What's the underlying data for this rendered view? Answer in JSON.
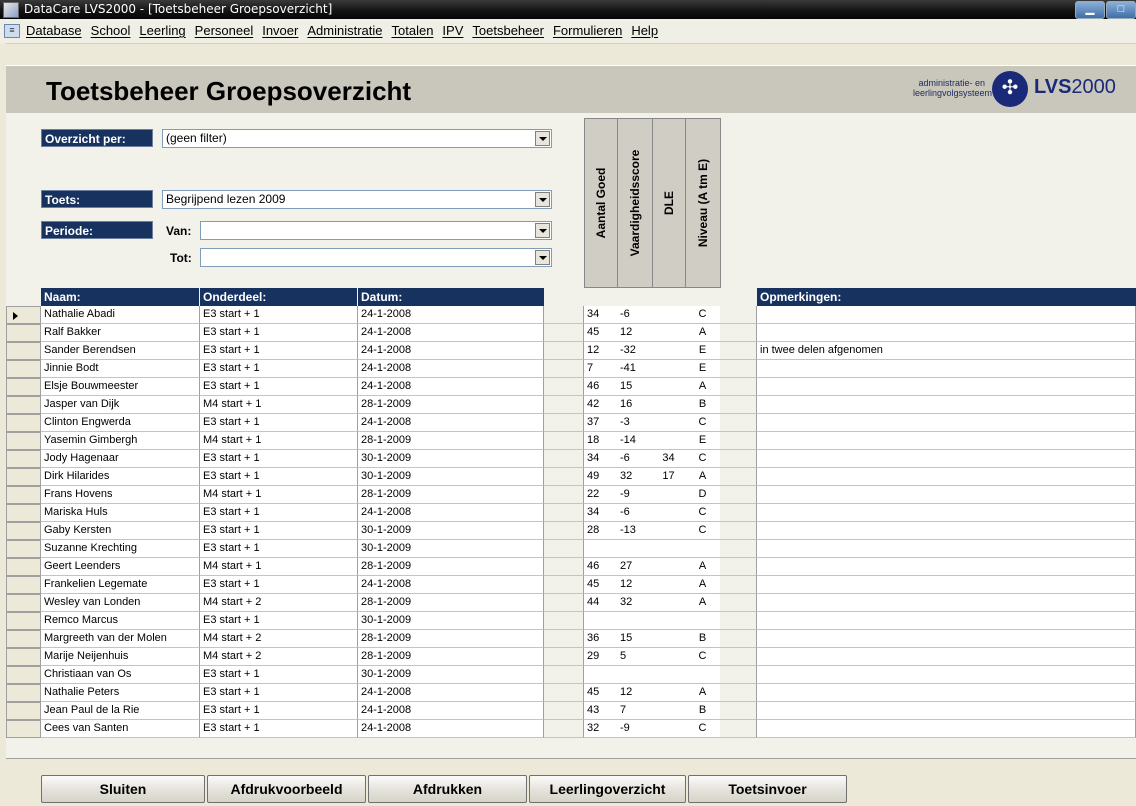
{
  "window": {
    "title": "DataCare LVS2000 - [Toetsbeheer Groepsoverzicht]",
    "buttons": [
      "▁",
      "□"
    ]
  },
  "menu": [
    "Database",
    "School",
    "Leerling",
    "Personeel",
    "Invoer",
    "Administratie",
    "Totalen",
    "IPV",
    "Toetsbeheer",
    "Formulieren",
    "Help"
  ],
  "header": {
    "title": "Toetsbeheer Groepsoverzicht",
    "logo_line1": "administratie- en",
    "logo_line2": "leerlingvolgsysteem",
    "logo_lvs": "LVS",
    "logo_year": "2000"
  },
  "filters": {
    "overzicht_label": "Overzicht per:",
    "overzicht_value": "(geen filter)",
    "toets_label": "Toets:",
    "toets_value": "Begrijpend lezen 2009",
    "periode_label": "Periode:",
    "van_label": "Van:",
    "van_value": "",
    "tot_label": "Tot:",
    "tot_value": ""
  },
  "vertical_headers": [
    "Aantal Goed",
    "Vaardigheidsscore",
    "DLE",
    "Niveau (A tm E)"
  ],
  "grid_headers": {
    "naam": "Naam:",
    "onderdeel": "Onderdeel:",
    "datum": "Datum:",
    "opmerkingen": "Opmerkingen:"
  },
  "rows": [
    {
      "naam": "Nathalie Abadi",
      "onderdeel": "E3 start + 1",
      "datum": "24-1-2008",
      "goed": "34",
      "vaard": "-6",
      "dle": "",
      "niveau": "C",
      "opm": ""
    },
    {
      "naam": "Ralf Bakker",
      "onderdeel": "E3 start + 1",
      "datum": "24-1-2008",
      "goed": "45",
      "vaard": "12",
      "dle": "",
      "niveau": "A",
      "opm": ""
    },
    {
      "naam": "Sander Berendsen",
      "onderdeel": "E3 start + 1",
      "datum": "24-1-2008",
      "goed": "12",
      "vaard": "-32",
      "dle": "",
      "niveau": "E",
      "opm": "in twee delen afgenomen"
    },
    {
      "naam": "Jinnie Bodt",
      "onderdeel": "E3 start + 1",
      "datum": "24-1-2008",
      "goed": "7",
      "vaard": "-41",
      "dle": "",
      "niveau": "E",
      "opm": ""
    },
    {
      "naam": "Elsje Bouwmeester",
      "onderdeel": "E3 start + 1",
      "datum": "24-1-2008",
      "goed": "46",
      "vaard": "15",
      "dle": "",
      "niveau": "A",
      "opm": ""
    },
    {
      "naam": "Jasper van Dijk",
      "onderdeel": "M4 start + 1",
      "datum": "28-1-2009",
      "goed": "42",
      "vaard": "16",
      "dle": "",
      "niveau": "B",
      "opm": ""
    },
    {
      "naam": "Clinton Engwerda",
      "onderdeel": "E3 start + 1",
      "datum": "24-1-2008",
      "goed": "37",
      "vaard": "-3",
      "dle": "",
      "niveau": "C",
      "opm": ""
    },
    {
      "naam": "Yasemin Gimbergh",
      "onderdeel": "M4 start + 1",
      "datum": "28-1-2009",
      "goed": "18",
      "vaard": "-14",
      "dle": "",
      "niveau": "E",
      "opm": ""
    },
    {
      "naam": "Jody Hagenaar",
      "onderdeel": "E3 start + 1",
      "datum": "30-1-2009",
      "goed": "34",
      "vaard": "-6",
      "dle": "34",
      "niveau": "C",
      "opm": ""
    },
    {
      "naam": "Dirk Hilarides",
      "onderdeel": "E3 start + 1",
      "datum": "30-1-2009",
      "goed": "49",
      "vaard": "32",
      "dle": "17",
      "niveau": "A",
      "opm": ""
    },
    {
      "naam": "Frans Hovens",
      "onderdeel": "M4 start + 1",
      "datum": "28-1-2009",
      "goed": "22",
      "vaard": "-9",
      "dle": "",
      "niveau": "D",
      "opm": ""
    },
    {
      "naam": "Mariska Huls",
      "onderdeel": "E3 start + 1",
      "datum": "24-1-2008",
      "goed": "34",
      "vaard": "-6",
      "dle": "",
      "niveau": "C",
      "opm": ""
    },
    {
      "naam": "Gaby Kersten",
      "onderdeel": "E3 start + 1",
      "datum": "30-1-2009",
      "goed": "28",
      "vaard": "-13",
      "dle": "",
      "niveau": "C",
      "opm": ""
    },
    {
      "naam": "Suzanne Krechting",
      "onderdeel": "E3 start + 1",
      "datum": "30-1-2009",
      "goed": "",
      "vaard": "",
      "dle": "",
      "niveau": "",
      "opm": ""
    },
    {
      "naam": "Geert Leenders",
      "onderdeel": "M4 start + 1",
      "datum": "28-1-2009",
      "goed": "46",
      "vaard": "27",
      "dle": "",
      "niveau": "A",
      "opm": ""
    },
    {
      "naam": "Frankelien Legemate",
      "onderdeel": "E3 start + 1",
      "datum": "24-1-2008",
      "goed": "45",
      "vaard": "12",
      "dle": "",
      "niveau": "A",
      "opm": ""
    },
    {
      "naam": "Wesley van Londen",
      "onderdeel": "M4 start + 2",
      "datum": "28-1-2009",
      "goed": "44",
      "vaard": "32",
      "dle": "",
      "niveau": "A",
      "opm": ""
    },
    {
      "naam": "Remco Marcus",
      "onderdeel": "E3 start + 1",
      "datum": "30-1-2009",
      "goed": "",
      "vaard": "",
      "dle": "",
      "niveau": "",
      "opm": ""
    },
    {
      "naam": "Margreeth van der Molen",
      "onderdeel": "M4 start + 2",
      "datum": "28-1-2009",
      "goed": "36",
      "vaard": "15",
      "dle": "",
      "niveau": "B",
      "opm": ""
    },
    {
      "naam": "Marije Neijenhuis",
      "onderdeel": "M4 start + 2",
      "datum": "28-1-2009",
      "goed": "29",
      "vaard": "5",
      "dle": "",
      "niveau": "C",
      "opm": ""
    },
    {
      "naam": "Christiaan van Os",
      "onderdeel": "E3 start + 1",
      "datum": "30-1-2009",
      "goed": "",
      "vaard": "",
      "dle": "",
      "niveau": "",
      "opm": ""
    },
    {
      "naam": "Nathalie Peters",
      "onderdeel": "E3 start + 1",
      "datum": "24-1-2008",
      "goed": "45",
      "vaard": "12",
      "dle": "",
      "niveau": "A",
      "opm": ""
    },
    {
      "naam": "Jean Paul de la Rie",
      "onderdeel": "E3 start + 1",
      "datum": "24-1-2008",
      "goed": "43",
      "vaard": "7",
      "dle": "",
      "niveau": "B",
      "opm": ""
    },
    {
      "naam": "Cees van Santen",
      "onderdeel": "E3 start + 1",
      "datum": "24-1-2008",
      "goed": "32",
      "vaard": "-9",
      "dle": "",
      "niveau": "C",
      "opm": ""
    }
  ],
  "footer_buttons": [
    "Sluiten",
    "Afdrukvoorbeeld",
    "Afdrukken",
    "Leerlingoverzicht",
    "Toetsinvoer"
  ]
}
